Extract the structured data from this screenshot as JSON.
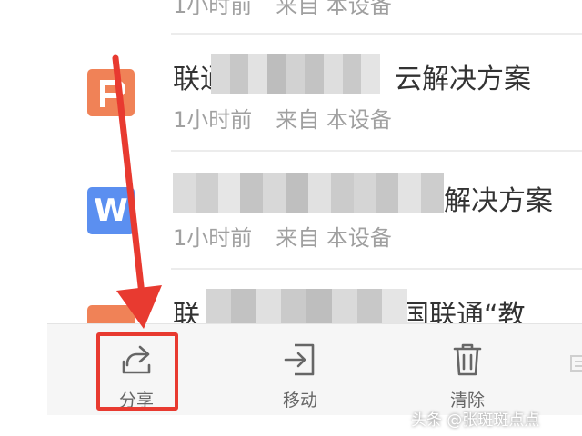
{
  "files": [
    {
      "title_visible": "",
      "time": "1小时前",
      "source": "来自 本设备",
      "icon": "ppt-icon"
    },
    {
      "title_prefix": "联通",
      "title_suffix": "云解决方案",
      "time": "1小时前",
      "source": "来自 本设备",
      "icon": "ppt-icon"
    },
    {
      "title_prefix": "",
      "title_suffix": "解决方案",
      "time": "1小时前",
      "source": "来自 本设备",
      "icon": "word-icon",
      "icon_letter": "W"
    },
    {
      "title_prefix": "联",
      "title_suffix": "国联通“教",
      "icon": "ppt-icon"
    }
  ],
  "toolbar": {
    "share": "分享",
    "move": "移动",
    "clear": "清除"
  },
  "watermark": "头条 @张斑斑点点",
  "colors": {
    "ppt": "#f08257",
    "word": "#5b8ff0",
    "annotation": "#e83a30"
  }
}
